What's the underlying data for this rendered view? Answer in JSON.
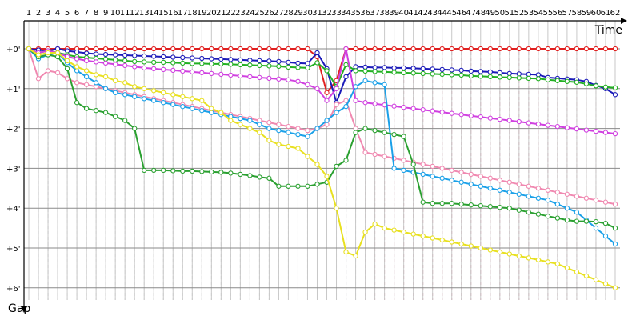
{
  "chart_data": {
    "type": "line",
    "xlabel": "Time",
    "ylabel": "Gap",
    "x_ticks": [
      "1",
      "2",
      "3",
      "4",
      "5",
      "6",
      "7",
      "8",
      "9",
      "10",
      "11",
      "12",
      "13",
      "14",
      "15",
      "16",
      "17",
      "18",
      "19",
      "20",
      "21",
      "22",
      "23",
      "24",
      "25",
      "26",
      "27",
      "28",
      "29",
      "30",
      "31",
      "32",
      "33",
      "34",
      "35",
      "36",
      "37",
      "38",
      "39",
      "40",
      "41",
      "42",
      "43",
      "44",
      "45",
      "46",
      "47",
      "48",
      "49",
      "50",
      "51",
      "52",
      "53",
      "54",
      "55",
      "56",
      "57",
      "58",
      "59",
      "60",
      "61",
      "62"
    ],
    "y_ticks": [
      "+0'",
      "+1'",
      "+2'",
      "+3'",
      "+4'",
      "+5'",
      "+6'"
    ],
    "ylim_minutes": [
      0,
      6
    ],
    "grid": true,
    "legend": "none",
    "lap_markers": {
      "grey": [
        2,
        3,
        4,
        5,
        6,
        7,
        8,
        9,
        10,
        11,
        12,
        13,
        14,
        15,
        16,
        17,
        18,
        19,
        20,
        21,
        22,
        23,
        24,
        25,
        26,
        27,
        28,
        29,
        30,
        31,
        32,
        33,
        34,
        35,
        36,
        37,
        38,
        39,
        40,
        41,
        42,
        43,
        44,
        45,
        46,
        47,
        48,
        49,
        50,
        51,
        52,
        53,
        54,
        55,
        56,
        57,
        58,
        59,
        60,
        61,
        62
      ],
      "pink": [
        36,
        37,
        38,
        39,
        40,
        41,
        42,
        43,
        44,
        45,
        46,
        47,
        48,
        49,
        50,
        51,
        52,
        53,
        54,
        55,
        56,
        57,
        58,
        59,
        60,
        61,
        62
      ],
      "magenta": [
        2,
        3,
        34
      ],
      "green": [
        2,
        3,
        34
      ]
    },
    "series": [
      {
        "color": "#e02020",
        "values": [
          0,
          0,
          0,
          0,
          0,
          0,
          0,
          0,
          0,
          0,
          0,
          0,
          0,
          0,
          0,
          0,
          0,
          0,
          0,
          0,
          0,
          0,
          0,
          0,
          0,
          0,
          0,
          0,
          0,
          0,
          0.2,
          1.1,
          0.8,
          0,
          0,
          0,
          0,
          0,
          0,
          0,
          0,
          0,
          0,
          0,
          0,
          0,
          0,
          0,
          0,
          0,
          0,
          0,
          0,
          0,
          0,
          0,
          0,
          0,
          0,
          0,
          0,
          0
        ]
      },
      {
        "color": "#1a1ab8",
        "values": [
          0,
          0.03,
          0.05,
          0,
          0.05,
          0.08,
          0.11,
          0.13,
          0.14,
          0.15,
          0.16,
          0.17,
          0.18,
          0.19,
          0.2,
          0.21,
          0.22,
          0.23,
          0.24,
          0.25,
          0.26,
          0.27,
          0.28,
          0.29,
          0.3,
          0.31,
          0.32,
          0.34,
          0.36,
          0.37,
          0.1,
          0.5,
          1.35,
          0.7,
          0.45,
          0.46,
          0.47,
          0.47,
          0.48,
          0.48,
          0.49,
          0.5,
          0.51,
          0.52,
          0.53,
          0.54,
          0.56,
          0.57,
          0.58,
          0.6,
          0.62,
          0.63,
          0.64,
          0.65,
          0.72,
          0.74,
          0.76,
          0.78,
          0.82,
          0.92,
          1.0,
          1.15
        ]
      },
      {
        "color": "#22b022",
        "values": [
          0,
          0.1,
          0.05,
          0.1,
          0.15,
          0.2,
          0.22,
          0.24,
          0.26,
          0.28,
          0.3,
          0.32,
          0.33,
          0.34,
          0.34,
          0.35,
          0.36,
          0.37,
          0.37,
          0.38,
          0.38,
          0.39,
          0.4,
          0.41,
          0.42,
          0.43,
          0.44,
          0.46,
          0.47,
          0.48,
          0.35,
          0.55,
          0.95,
          0.4,
          0.55,
          0.56,
          0.57,
          0.58,
          0.59,
          0.6,
          0.61,
          0.62,
          0.63,
          0.64,
          0.65,
          0.66,
          0.68,
          0.69,
          0.7,
          0.71,
          0.72,
          0.73,
          0.74,
          0.75,
          0.78,
          0.8,
          0.82,
          0.84,
          0.88,
          0.93,
          0.96,
          0.98
        ]
      },
      {
        "color": "#d040e0",
        "values": [
          0,
          0.1,
          0.05,
          0.1,
          0.2,
          0.25,
          0.3,
          0.33,
          0.36,
          0.39,
          0.42,
          0.45,
          0.48,
          0.5,
          0.52,
          0.54,
          0.56,
          0.58,
          0.6,
          0.62,
          0.64,
          0.66,
          0.68,
          0.7,
          0.72,
          0.74,
          0.76,
          0.78,
          0.82,
          0.9,
          1.0,
          1.3,
          1.0,
          0,
          1.3,
          1.35,
          1.38,
          1.41,
          1.44,
          1.47,
          1.5,
          1.53,
          1.56,
          1.59,
          1.62,
          1.65,
          1.68,
          1.71,
          1.74,
          1.77,
          1.8,
          1.83,
          1.86,
          1.89,
          1.92,
          1.95,
          1.98,
          2.01,
          2.04,
          2.07,
          2.1,
          2.13
        ]
      },
      {
        "color": "#f088b0",
        "values": [
          0,
          0.75,
          0.55,
          0.6,
          0.75,
          0.85,
          0.9,
          0.95,
          1.0,
          1.05,
          1.1,
          1.15,
          1.2,
          1.25,
          1.3,
          1.35,
          1.4,
          1.45,
          1.5,
          1.55,
          1.6,
          1.65,
          1.7,
          1.75,
          1.8,
          1.85,
          1.9,
          1.95,
          2.0,
          2.05,
          2.0,
          1.9,
          1.4,
          1.3,
          2.0,
          2.6,
          2.65,
          2.7,
          2.75,
          2.8,
          2.85,
          2.9,
          2.95,
          3.0,
          3.05,
          3.1,
          3.15,
          3.2,
          3.25,
          3.3,
          3.35,
          3.4,
          3.45,
          3.5,
          3.55,
          3.6,
          3.65,
          3.7,
          3.75,
          3.8,
          3.85,
          3.9
        ]
      },
      {
        "color": "#1aa0e8",
        "values": [
          0,
          0.25,
          0.15,
          0.1,
          0.35,
          0.55,
          0.7,
          0.85,
          1.0,
          1.1,
          1.15,
          1.2,
          1.25,
          1.3,
          1.35,
          1.4,
          1.45,
          1.5,
          1.55,
          1.6,
          1.65,
          1.7,
          1.75,
          1.8,
          1.9,
          2.0,
          2.05,
          2.1,
          2.15,
          2.2,
          2.0,
          1.8,
          1.6,
          1.45,
          0.95,
          0.8,
          0.85,
          0.9,
          3.0,
          3.05,
          3.1,
          3.15,
          3.2,
          3.25,
          3.3,
          3.35,
          3.4,
          3.45,
          3.5,
          3.55,
          3.6,
          3.65,
          3.7,
          3.75,
          3.8,
          3.9,
          4.0,
          4.1,
          4.3,
          4.5,
          4.7,
          4.9
        ]
      },
      {
        "color": "#2aa030",
        "values": [
          0,
          0.2,
          0.15,
          0.2,
          0.5,
          1.35,
          1.5,
          1.55,
          1.6,
          1.7,
          1.8,
          2.0,
          3.05,
          3.05,
          3.05,
          3.06,
          3.07,
          3.07,
          3.08,
          3.09,
          3.1,
          3.12,
          3.15,
          3.18,
          3.22,
          3.25,
          3.45,
          3.45,
          3.45,
          3.45,
          3.4,
          3.35,
          2.95,
          2.8,
          2.1,
          2.0,
          2.05,
          2.1,
          2.15,
          2.2,
          2.9,
          3.85,
          3.88,
          3.88,
          3.88,
          3.9,
          3.92,
          3.94,
          3.96,
          3.98,
          4.0,
          4.05,
          4.1,
          4.15,
          4.2,
          4.25,
          4.3,
          4.33,
          4.33,
          4.34,
          4.38,
          4.5
        ]
      },
      {
        "color": "#e8e020",
        "values": [
          0,
          0.15,
          0.1,
          0.1,
          0.3,
          0.45,
          0.55,
          0.65,
          0.7,
          0.8,
          0.85,
          0.95,
          1.0,
          1.05,
          1.1,
          1.15,
          1.2,
          1.25,
          1.3,
          1.5,
          1.6,
          1.8,
          1.9,
          2.0,
          2.1,
          2.3,
          2.4,
          2.45,
          2.5,
          2.7,
          2.9,
          3.2,
          4.0,
          5.1,
          5.2,
          4.6,
          4.4,
          4.5,
          4.55,
          4.6,
          4.65,
          4.7,
          4.75,
          4.8,
          4.85,
          4.9,
          4.95,
          5.0,
          5.05,
          5.1,
          5.15,
          5.2,
          5.25,
          5.3,
          5.35,
          5.4,
          5.5,
          5.6,
          5.7,
          5.8,
          5.9,
          6.0
        ]
      }
    ]
  }
}
